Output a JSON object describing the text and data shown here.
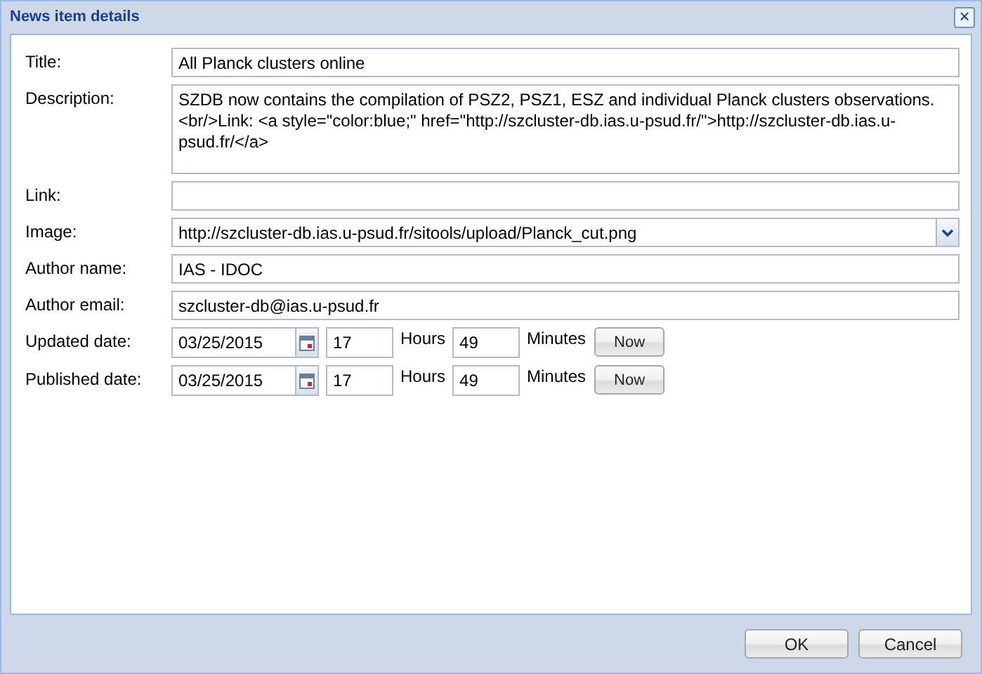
{
  "window": {
    "title": "News item details",
    "close": "×"
  },
  "fields": [
    {
      "kind": "text",
      "label": "Title:",
      "value": "All Planck clusters online"
    },
    {
      "kind": "textarea",
      "label": "Description:",
      "value": "SZDB now contains the compilation of PSZ2, PSZ1, ESZ and individual Planck clusters observations.<br/>Link: <a style=\"color:blue;\" href=\"http://szcluster-db.ias.u-psud.fr/\">http://szcluster-db.ias.u-psud.fr/</a>"
    },
    {
      "kind": "text",
      "label": "Link:"
    },
    {
      "kind": "combo",
      "label": "Image:",
      "value": "http://szcluster-db.ias.u-psud.fr/sitools/upload/Planck_cut.png"
    },
    {
      "kind": "text",
      "label": "Author name:",
      "value": "IAS - IDOC"
    },
    {
      "kind": "text",
      "label": "Author email:",
      "value": "szcluster-db@ias.u-psud.fr"
    },
    {
      "kind": "datetime",
      "label": "Updated date:",
      "date": "03/25/2015",
      "hours": "17",
      "hours_label": "Hours",
      "minutes": "49",
      "minutes_label": "Minutes",
      "button": "Now"
    },
    {
      "kind": "datetime",
      "label": "Published date:",
      "date": "03/25/2015",
      "hours": "17",
      "hours_label": "Hours",
      "minutes": "49",
      "minutes_label": "Minutes",
      "button": "Now"
    }
  ],
  "buttons": [
    "OK",
    "Cancel"
  ]
}
